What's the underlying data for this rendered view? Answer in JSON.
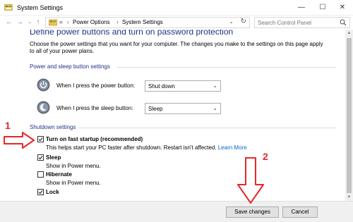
{
  "window": {
    "title": "System Settings"
  },
  "nav": {
    "address_overflow": "«",
    "breadcrumbs": [
      "Power Options",
      "System Settings"
    ],
    "search": {
      "placeholder": "Search Control Panel",
      "value": ""
    }
  },
  "main": {
    "heading": "Define power buttons and turn on password protection",
    "description": "Choose the power settings that you want for your computer. The changes you make to the settings on this page apply to all of your power plans.",
    "power_sleep_section": "Power and sleep button settings",
    "power_button": {
      "label": "When I press the power button:",
      "value": "Shut down"
    },
    "sleep_button": {
      "label": "When I press the sleep button:",
      "value": "Sleep"
    },
    "shutdown_section": "Shutdown settings",
    "options": [
      {
        "label": "Turn on fast startup (recommended)",
        "checked": true,
        "description": "This helps start your PC faster after shutdown. Restart isn't affected.",
        "link": "Learn More"
      },
      {
        "label": "Sleep",
        "checked": true,
        "description": "Show in Power menu."
      },
      {
        "label": "Hibernate",
        "checked": false,
        "description": "Show in Power menu."
      },
      {
        "label": "Lock",
        "checked": true,
        "description": ""
      }
    ]
  },
  "footer": {
    "save_label": "Save changes",
    "cancel_label": "Cancel"
  },
  "annotations": {
    "one": "1",
    "two": "2"
  },
  "colors": {
    "heading": "#1e3287",
    "link": "#0066cc",
    "annotation": "#e8262a",
    "footer_bg": "#f0f0f0"
  },
  "icons": [
    "control-panel-icon",
    "back-arrow-icon",
    "forward-arrow-icon",
    "recent-dropdown-icon",
    "up-arrow-icon",
    "refresh-icon",
    "search-icon",
    "power-button-icon",
    "sleep-moon-icon",
    "checkbox-check-icon"
  ]
}
